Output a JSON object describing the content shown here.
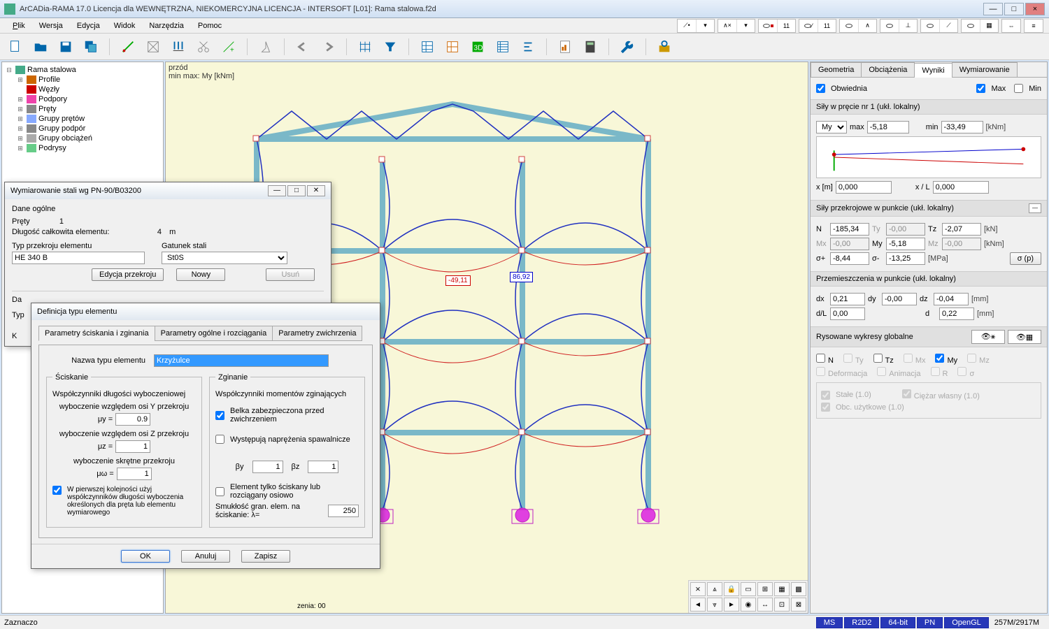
{
  "window": {
    "title": "ArCADia-RAMA 17.0 Licencja dla WEWNĘTRZNA, NIEKOMERCYJNA LICENCJA - INTERSOFT [L01]: Rama stalowa.f2d"
  },
  "menu": {
    "plik": "Plik",
    "wersja": "Wersja",
    "edycja": "Edycja",
    "widok": "Widok",
    "narzedzia": "Narzędzia",
    "pomoc": "Pomoc"
  },
  "tree": {
    "root": "Rama stalowa",
    "items": [
      "Profile",
      "Węzły",
      "Podpory",
      "Pręty",
      "Grupy prętów",
      "Grupy podpór",
      "Grupy obciążeń",
      "Podrysy"
    ]
  },
  "canvas": {
    "label1": "przód",
    "label2": "min max: My [kNm]",
    "val_neg": "-49,11",
    "val_pos": "86,92",
    "status": "zenia: 00"
  },
  "right": {
    "tabs": {
      "geom": "Geometria",
      "obc": "Obciążenia",
      "wyn": "Wyniki",
      "wym": "Wymiarowanie"
    },
    "obw": {
      "label": "Obwiednia",
      "max": "Max",
      "min": "Min"
    },
    "sily_head": "Siły w pręcie nr 1 (ukł. lokalny)",
    "my": "My",
    "max_l": "max",
    "max_v": "-5,18",
    "min_l": "min",
    "min_v": "-33,49",
    "knm": "[kNm]",
    "xm_l": "x [m]",
    "xm_v": "0,000",
    "xL_l": "x / L",
    "xL_v": "0,000",
    "przek_head": "Siły przekrojowe w punkcie (ukł. lokalny)",
    "N_l": "N",
    "N_v": "-185,34",
    "Ty_l": "Ty",
    "Ty_v": "-0,00",
    "Tz_l": "Tz",
    "Tz_v": "-2,07",
    "kN": "[kN]",
    "Mx_l": "Mx",
    "Mx_v": "-0,00",
    "My_l": "My",
    "My_v": "-5,18",
    "Mz_l": "Mz",
    "Mz_v": "-0,00",
    "sp_l": "σ+",
    "sp_v": "-8,44",
    "sm_l": "σ-",
    "sm_v": "-13,25",
    "mpa": "[MPa]",
    "sigbtn": "σ (p)",
    "prz_head": "Przemieszczenia w punkcie (ukł. lokalny)",
    "dx_l": "dx",
    "dx_v": "0,21",
    "dy_l": "dy",
    "dy_v": "-0,00",
    "dz_l": "dz",
    "dz_v": "-0,04",
    "mm": "[mm]",
    "dL_l": "d/L",
    "dL_v": "0,00",
    "d_l": "d",
    "d_v": "0,22",
    "rys_head": "Rysowane wykresy globalne",
    "chk": {
      "N": "N",
      "Ty": "Ty",
      "Tz": "Tz",
      "Mx": "Mx",
      "My": "My",
      "Mz": "Mz",
      "Def": "Deformacja",
      "An": "Animacja",
      "R": "R",
      "s": "σ",
      "St": "Stałe (1.0)",
      "Cw": "Ciężar własny (1.0)",
      "Ou": "Obc. użytkowe (1.0)"
    }
  },
  "dlg1": {
    "title": "Wymiarowanie stali wg PN-90/B03200",
    "dane": "Dane ogólne",
    "prety_l": "Pręty",
    "prety_v": "1",
    "dlug_l": "Długość całkowita elementu:",
    "dlug_v": "4",
    "dlug_u": "m",
    "typ_l": "Typ przekroju elementu",
    "typ_v": "HE 340 B",
    "gat_l": "Gatunek stali",
    "gat_v": "St0S",
    "ed_btn": "Edycja przekroju",
    "nowy_btn": "Nowy",
    "usun_btn": "Usuń",
    "da_l": "Da",
    "typ2_l": "Typ",
    "k_l": "K"
  },
  "dlg2": {
    "title": "Definicja typu elementu",
    "tabs": {
      "t1": "Parametry ściskania i zginania",
      "t2": "Parametry ogólne i rozciągania",
      "t3": "Parametry zwichrzenia"
    },
    "nazwa_l": "Nazwa typu elementu",
    "nazwa_v": "Krzyżulce",
    "scisk": "Ściskanie",
    "wsp_dl": "Współczynniki długości wyboczeniowej",
    "wy_y": "wyboczenie względem osi Y przekroju",
    "mu_y_l": "μy   =",
    "mu_y_v": "0.9",
    "wy_z": "wyboczenie względem osi Z przekroju",
    "mu_z_l": "μz   =",
    "mu_z_v": "1",
    "wy_sk": "wyboczenie skrętne przekroju",
    "mu_w_l": "μω   =",
    "mu_w_v": "1",
    "pierw": "W pierwszej kolejności użyj współczynników długości wyboczenia określonych dla pręta lub elementu wymiarowego",
    "zgin": "Zginanie",
    "wsp_m": "Współczynniki momentów zginających",
    "belka": "Belka zabezpieczona przed zwichrzeniem",
    "wyst": "Występują naprężenia spawalnicze",
    "by_l": "βy",
    "by_v": "1",
    "bz_l": "βz",
    "bz_v": "1",
    "elem": "Element tylko ściskany lub rozciągany osiowo",
    "smuk_l": "Smukłość gran. elem. na ściskanie:   λ=",
    "smuk_v": "250",
    "ok": "OK",
    "anuluj": "Anuluj",
    "zapisz": "Zapisz"
  },
  "status": {
    "left": "Zaznaczo",
    "ms": "MS",
    "r2d2": "R2D2",
    "bit": "64-bit",
    "pn": "PN",
    "ogl": "OpenGL",
    "mem": "257M/2917M"
  }
}
